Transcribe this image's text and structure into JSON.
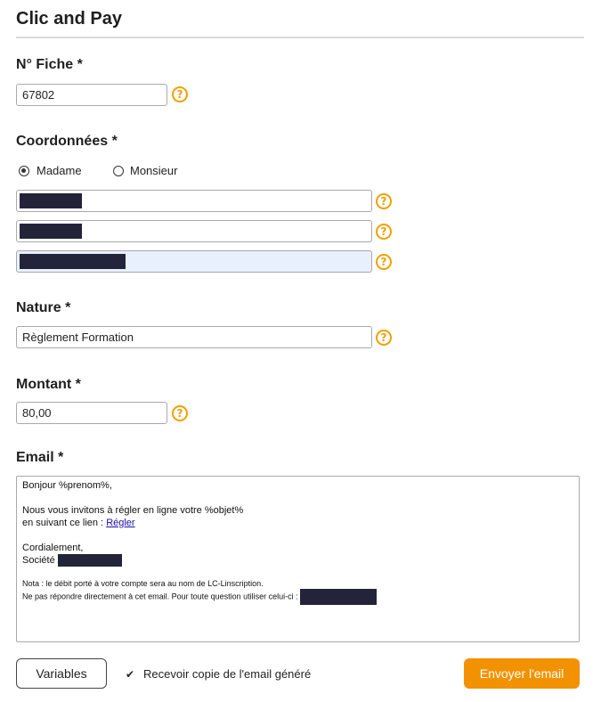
{
  "page": {
    "title": "Clic and Pay"
  },
  "fiche": {
    "label": "N° Fiche *",
    "value": "67802"
  },
  "coordonnees": {
    "label": "Coordonnées *",
    "civilite": [
      {
        "label": "Madame",
        "checked": true
      },
      {
        "label": "Monsieur",
        "checked": false
      }
    ],
    "field1": "",
    "field2": "",
    "field3": ""
  },
  "nature": {
    "label": "Nature *",
    "value": "Règlement Formation"
  },
  "montant": {
    "label": "Montant *",
    "value": "80,00"
  },
  "email": {
    "label": "Email *",
    "greeting": "Bonjour %prenom%,",
    "line1": "Nous vous invitons à régler en ligne votre %objet%",
    "line2_prefix": "en suivant ce lien :",
    "link": "Régler",
    "closing": "Cordialement,",
    "company_prefix": "Société",
    "note1": "Nota : le débit porté à votre compte sera au nom de LC-Linscription.",
    "note2": "Ne pas répondre directement à cet email. Pour toute question utiliser celui-ci :"
  },
  "help_glyph": "?",
  "actions": {
    "variables": "Variables",
    "copy_label": "Recevoir copie de l'email généré",
    "copy_checked": true,
    "copy_glyph": "✔",
    "send": "Envoyer l'email"
  },
  "colors": {
    "accent": "#f39200",
    "help": "#f0a000",
    "autofill": "#e8f0fe"
  }
}
